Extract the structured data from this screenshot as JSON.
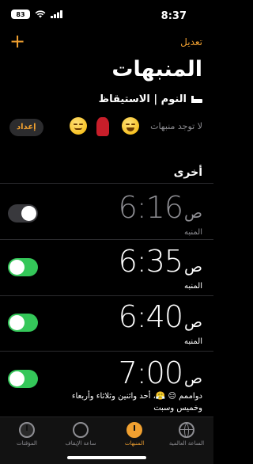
{
  "status_bar": {
    "time": "8:37",
    "battery_level": "83",
    "icons": [
      "signal-icon",
      "wifi-icon",
      "battery-icon"
    ]
  },
  "nav": {
    "edit_label": "تعديل",
    "add_icon": "plus-icon"
  },
  "title": "المنبهات",
  "sleep": {
    "header": "النوم | الاستيقاظ",
    "no_alarms_text": "لا توجد منبهات",
    "setup_label": "إعداد",
    "emojis": [
      "face-with-tears-of-joy",
      "woman-dancing",
      "relieved-face"
    ]
  },
  "other_section_title": "أخرى",
  "alarms": [
    {
      "time": "6:16",
      "ampm": "ص",
      "label": "المنبه",
      "enabled": false
    },
    {
      "time": "6:35",
      "ampm": "ص",
      "label": "المنبه",
      "enabled": true
    },
    {
      "time": "6:40",
      "ampm": "ص",
      "label": "المنبه",
      "enabled": true
    },
    {
      "time": "7:00",
      "ampm": "ص",
      "label": "دواممم 😑 😤، أحد واثنين وثلاثاء وأربعاء وخميس وسبت",
      "enabled": true
    }
  ],
  "tabs": [
    {
      "label": "الساعة العالمية",
      "icon": "globe-icon",
      "active": false
    },
    {
      "label": "المنبهات",
      "icon": "alarm-clock-icon",
      "active": true
    },
    {
      "label": "ساعة الإيقاف",
      "icon": "stopwatch-icon",
      "active": false
    },
    {
      "label": "المؤقتات",
      "icon": "timer-icon",
      "active": false
    }
  ],
  "colors": {
    "accent": "#f0a030",
    "toggle_on": "#34c759",
    "toggle_off": "#39393d",
    "secondary_text": "#8e8e93"
  }
}
